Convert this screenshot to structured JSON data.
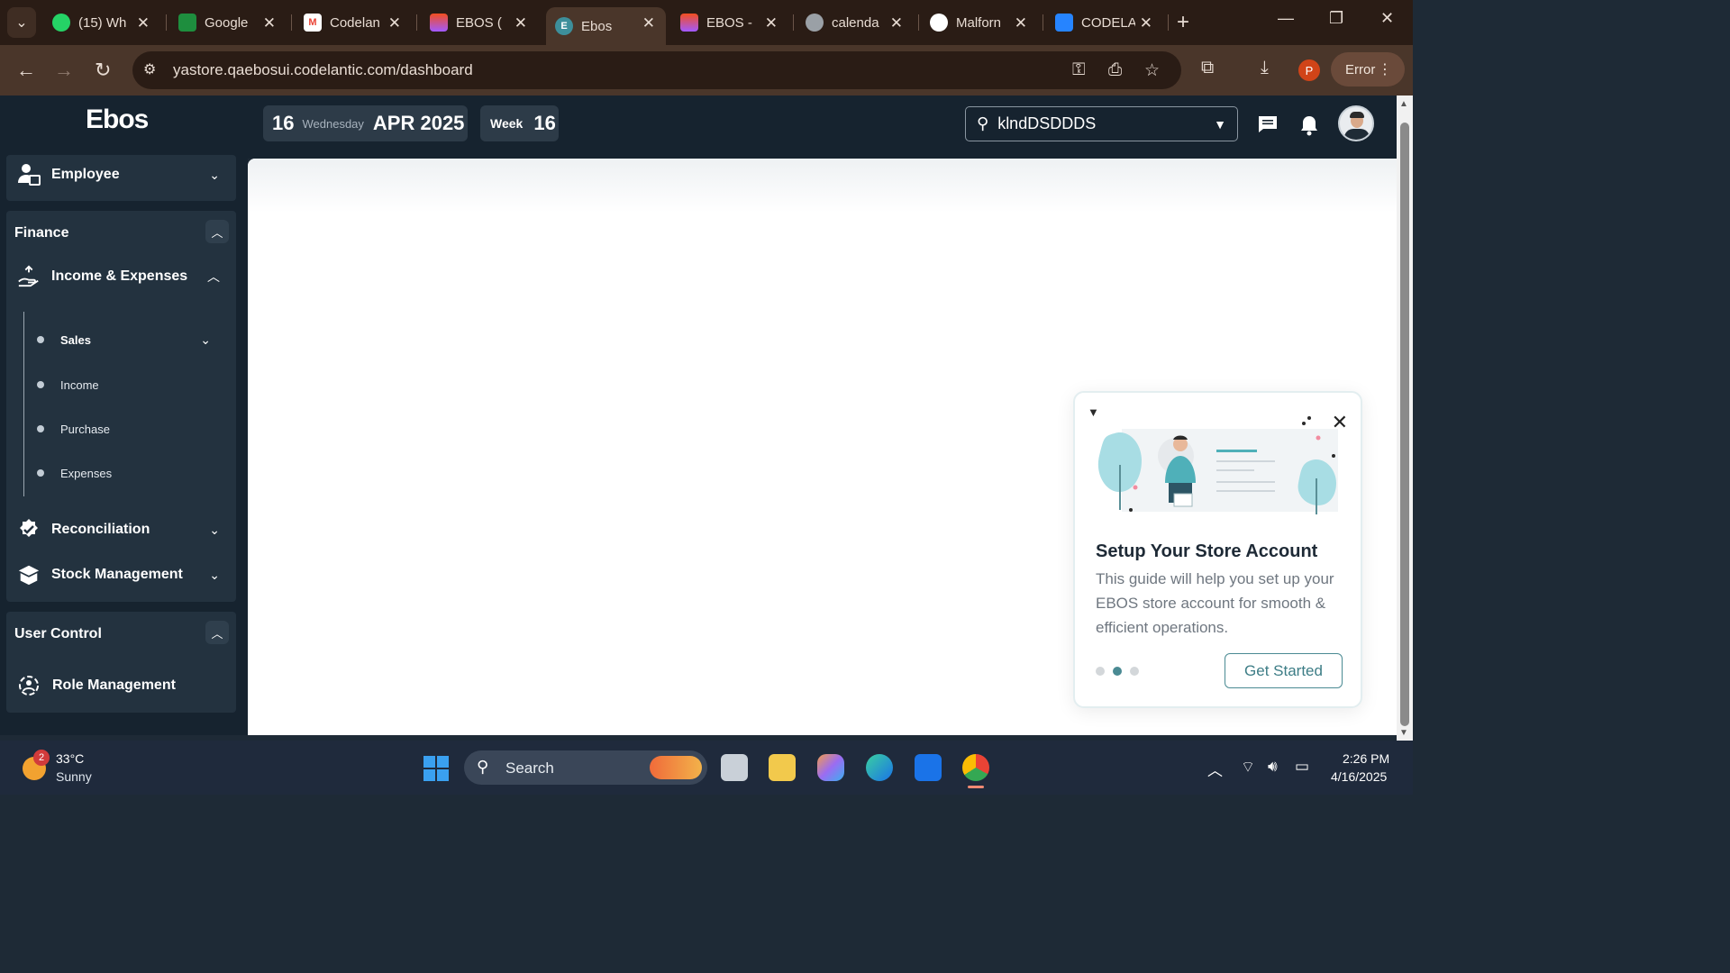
{
  "browser": {
    "tabs": [
      {
        "title": "(15) Wh",
        "favicon": "whatsapp-icon",
        "color": "#25d366"
      },
      {
        "title": "Google",
        "favicon": "google-meet-icon",
        "color": "#1e8e3e"
      },
      {
        "title": "Codelan",
        "favicon": "gmail-icon",
        "color": "#ea4335"
      },
      {
        "title": "EBOS (",
        "favicon": "figma-icon",
        "color": "#f24e1e"
      },
      {
        "title": "Ebos",
        "favicon": "ebos-icon",
        "color": "#3d8f9b"
      },
      {
        "title": "EBOS -",
        "favicon": "figma-icon",
        "color": "#f24e1e"
      },
      {
        "title": "calenda",
        "favicon": "globe-icon",
        "color": "#9aa0a6"
      },
      {
        "title": "Malforn",
        "favicon": "openai-icon",
        "color": "#ffffff"
      },
      {
        "title": "CODELA",
        "favicon": "confluence-icon",
        "color": "#2684ff"
      }
    ],
    "active_tab_index": 4,
    "url": "yastore.qaebosui.codelantic.com/dashboard",
    "profile_initial": "P",
    "error_label": "Error"
  },
  "app": {
    "logo": "Ebos",
    "date": {
      "day": "16",
      "weekday": "Wednesday",
      "month_year": "APR 2025"
    },
    "week": {
      "label": "Week",
      "number": "16"
    },
    "location": "klndDSDDDS"
  },
  "sidebar": {
    "employee": {
      "label": "Employee",
      "icon": "employee-icon"
    },
    "finance": {
      "title": "Finance",
      "income_expenses": {
        "label": "Income & Expenses",
        "icon": "hand-coin-icon"
      },
      "sub_items": [
        "Sales",
        "Income",
        "Purchase",
        "Expenses"
      ],
      "reconciliation": {
        "label": "Reconciliation",
        "icon": "check-badge-icon"
      },
      "stock_management": {
        "label": "Stock Management",
        "icon": "box-icon"
      }
    },
    "user_control": {
      "title": "User Control",
      "role_management": {
        "label": "Role Management",
        "icon": "role-icon"
      }
    }
  },
  "setup_card": {
    "title": "Setup Your Store Account",
    "description": "This guide will help you set up your EBOS store account for smooth & efficient operations.",
    "step_count": 3,
    "active_step": 2,
    "button_label": "Get Started",
    "accent": "#4a8a93"
  },
  "taskbar": {
    "weather_temp": "33°C",
    "weather_condition": "Sunny",
    "weather_badge": "2",
    "search_placeholder": "Search",
    "time": "2:26 PM",
    "date": "4/16/2025"
  }
}
